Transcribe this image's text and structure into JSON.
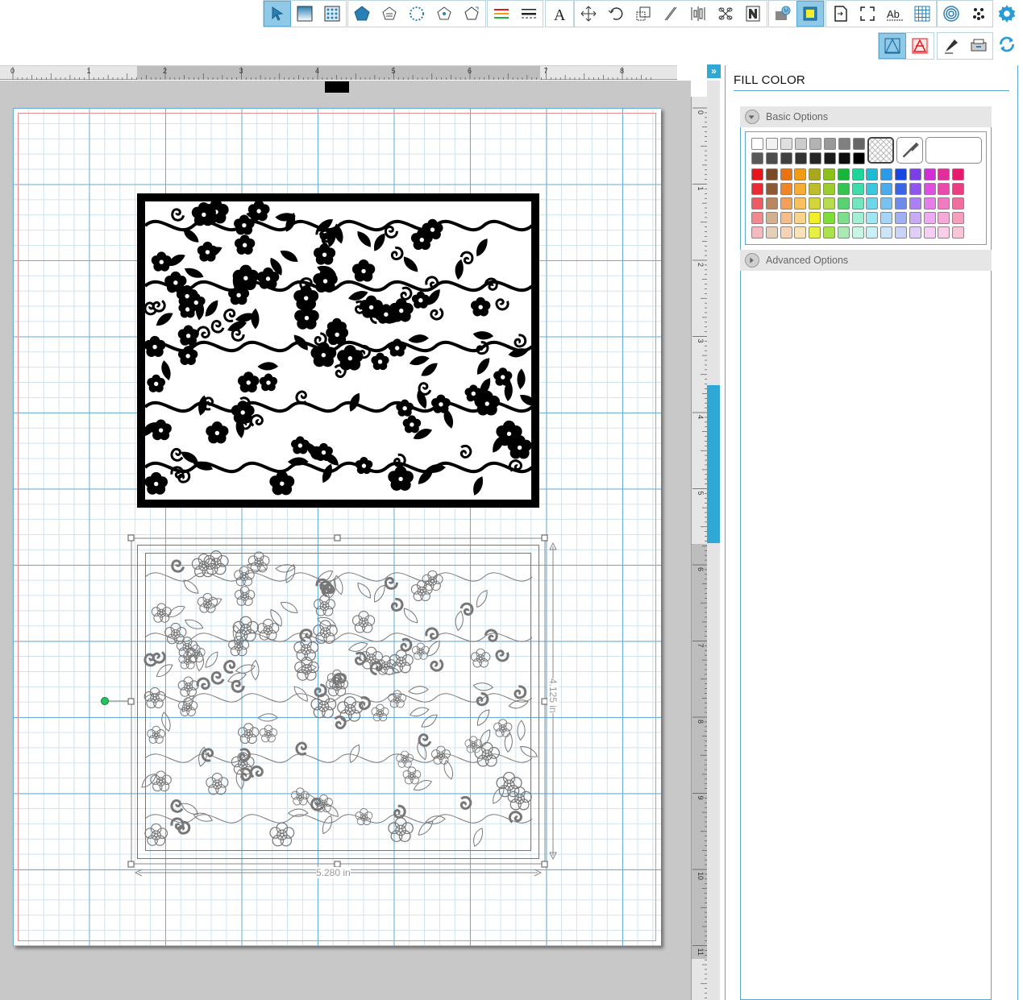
{
  "toolbar": {
    "groups": [
      {
        "name": "select",
        "tools": [
          "select-tool",
          "fill-panel-tool",
          "pattern-fill-tool"
        ],
        "active": 0
      },
      {
        "name": "shapes",
        "tools": [
          "shape-tool",
          "sketch-tool",
          "point-edit-tool",
          "polygon-tool",
          "pentagon-tool"
        ]
      },
      {
        "name": "lines",
        "tools": [
          "line-color-tool",
          "line-style-tool"
        ]
      },
      {
        "name": "text",
        "tools": [
          "text-tool"
        ]
      },
      {
        "name": "transform",
        "tools": [
          "move-tool",
          "rotate-tool",
          "scale-tool",
          "shear-tool",
          "align-tool",
          "replicate-tool",
          "nest-tool"
        ]
      },
      {
        "name": "media",
        "tools": [
          "media-tool",
          "print-cut-tool"
        ]
      },
      {
        "name": "page",
        "tools": [
          "page-setup-tool",
          "registration-tool",
          "text-style-tool",
          "grid-tool"
        ]
      },
      {
        "name": "misc",
        "tools": [
          "offset-tool",
          "trace-tool"
        ]
      }
    ],
    "row2": [
      "fill-tool-active",
      "line-fill-tool",
      "sketch-pen-tool",
      "send-to-cutter-tool"
    ]
  },
  "ruler": {
    "h_labels": [
      "0",
      "1",
      "2",
      "3",
      "4",
      "5",
      "6",
      "7",
      "8"
    ],
    "v_labels": [
      "0",
      "1",
      "2",
      "3",
      "4",
      "5",
      "6",
      "7",
      "8",
      "9",
      "10",
      "11"
    ]
  },
  "canvas": {
    "width_label": "5.280 in",
    "height_label": "4.125 in"
  },
  "panel": {
    "title": "FILL COLOR",
    "basic_options": "Basic Options",
    "advanced_options": "Advanced Options",
    "grays": [
      "#ffffff",
      "#f2f2f2",
      "#e0e0e0",
      "#cccccc",
      "#b3b3b3",
      "#999999",
      "#808080",
      "#666666"
    ],
    "darks": [
      "#595959",
      "#4d4d4d",
      "#404040",
      "#333333",
      "#262626",
      "#1a1a1a",
      "#0d0d0d",
      "#000000"
    ],
    "rows": [
      [
        "#e8141c",
        "#7a4a26",
        "#e87313",
        "#f29b17",
        "#a8a81c",
        "#8bc11b",
        "#18b53a",
        "#1fd498",
        "#1dbbd4",
        "#2a9bea",
        "#1747e0",
        "#7b3fe8",
        "#d12ed6",
        "#e02e9a",
        "#e51b6e"
      ],
      [
        "#ea2b34",
        "#8d5a35",
        "#ee8628",
        "#f5ad35",
        "#bebe2c",
        "#9ccc30",
        "#36c350",
        "#3fdcaa",
        "#3bc7de",
        "#4aabef",
        "#3a64e6",
        "#9055ee",
        "#de4ee1",
        "#e84bab",
        "#ea3d82"
      ],
      [
        "#ec5b62",
        "#b9875d",
        "#f2a05a",
        "#f8c160",
        "#d4d43f",
        "#b7dc4f",
        "#59d26f",
        "#71e6bf",
        "#6dd6ea",
        "#78c1f3",
        "#6c8bed",
        "#ab80f2",
        "#e67de9",
        "#ef7cc3",
        "#ef6f9f"
      ],
      [
        "#f08a90",
        "#d3b08e",
        "#f5bd8c",
        "#fad48e",
        "#f2ee2c",
        "#7fdd3a",
        "#7dde8c",
        "#a4efd3",
        "#9fe5f2",
        "#a6d5f7",
        "#9fb1f3",
        "#c8aaf6",
        "#efaaf1",
        "#f5a9d7",
        "#f4a0bd"
      ],
      [
        "#f6b9bd",
        "#e5cfb8",
        "#f7d3b6",
        "#fce2b8",
        "#e6f044",
        "#a9e24d",
        "#a9eab4",
        "#c8f6e5",
        "#c8f0f7",
        "#cbe5fa",
        "#c9d5f8",
        "#e0cff9",
        "#f6cff7",
        "#f9cee8",
        "#f8c6d7"
      ]
    ]
  }
}
